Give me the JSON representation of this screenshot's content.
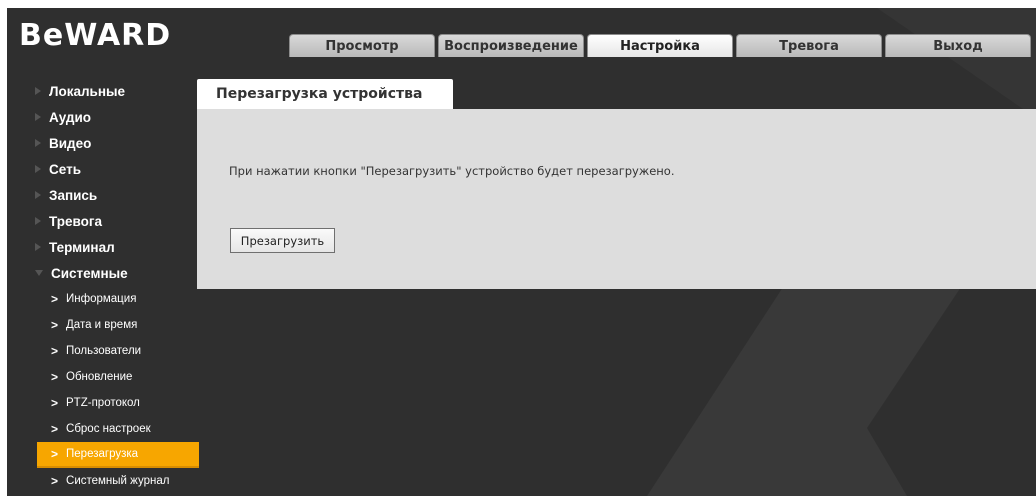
{
  "app": {
    "logo": "BeWARD"
  },
  "tabs": [
    {
      "label": "Просмотр"
    },
    {
      "label": "Воспроизведение"
    },
    {
      "label": "Настройка"
    },
    {
      "label": "Тревога"
    },
    {
      "label": "Выход"
    }
  ],
  "active_tab": "Настройка",
  "sidebar": {
    "groups": [
      {
        "label": "Локальные"
      },
      {
        "label": "Аудио"
      },
      {
        "label": "Видео"
      },
      {
        "label": "Сеть"
      },
      {
        "label": "Запись"
      },
      {
        "label": "Тревога"
      },
      {
        "label": "Терминал"
      },
      {
        "label": "Системные"
      }
    ],
    "sub_items": [
      {
        "label": "Информация"
      },
      {
        "label": "Дата и время"
      },
      {
        "label": "Пользователи"
      },
      {
        "label": "Обновление"
      },
      {
        "label": "PTZ-протокол"
      },
      {
        "label": "Сброс настроек"
      },
      {
        "label": "Перезагрузка"
      },
      {
        "label": "Системный журнал"
      }
    ],
    "active_item": "Перезагрузка"
  },
  "panel": {
    "title": "Перезагрузка устройства",
    "description": "При нажатии кнопки \"Перезагрузить\" устройство будет перезагружено.",
    "button_label": "Презагрузить"
  },
  "colors": {
    "accent": "#f7a600",
    "background": "#2f2f2f",
    "panel": "#dddddd"
  }
}
